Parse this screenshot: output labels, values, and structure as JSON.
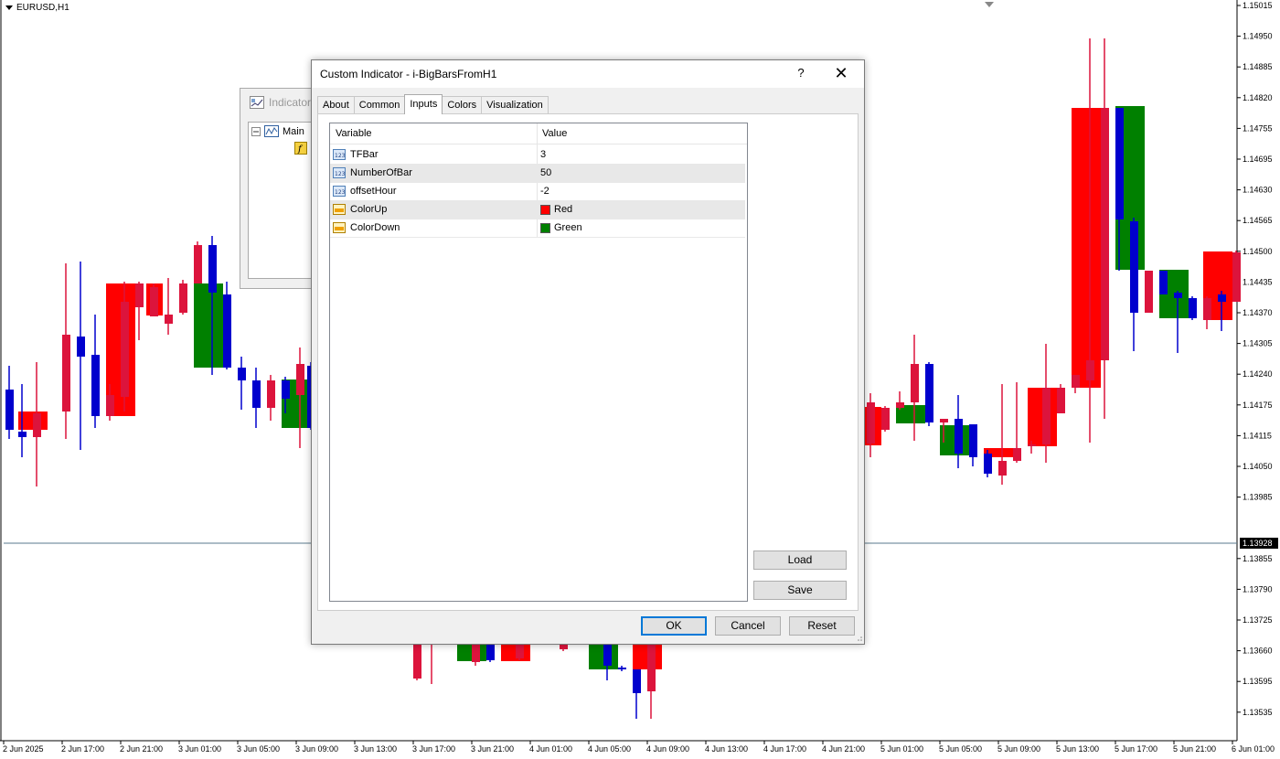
{
  "chart": {
    "symbol_label": "EURUSD,H1",
    "current_price": "1.13928",
    "price_labels": [
      "1.15015",
      "1.14950",
      "1.14885",
      "1.14820",
      "1.14755",
      "1.14695",
      "1.14630",
      "1.14565",
      "1.14500",
      "1.14435",
      "1.14370",
      "1.14305",
      "1.14240",
      "1.14175",
      "1.14115",
      "1.14050",
      "1.13985",
      "1.13855",
      "1.13790",
      "1.13725",
      "1.13660",
      "1.13595",
      "1.13535"
    ],
    "time_labels": [
      "2 Jun 2025",
      "2 Jun 17:00",
      "2 Jun 21:00",
      "3 Jun 01:00",
      "3 Jun 05:00",
      "3 Jun 09:00",
      "3 Jun 13:00",
      "3 Jun 17:00",
      "3 Jun 21:00",
      "4 Jun 01:00",
      "4 Jun 05:00",
      "4 Jun 09:00",
      "4 Jun 13:00",
      "4 Jun 17:00",
      "4 Jun 21:00",
      "5 Jun 01:00",
      "5 Jun 05:00",
      "5 Jun 09:00",
      "5 Jun 13:00",
      "5 Jun 17:00",
      "5 Jun 21:00",
      "6 Jun 01:00"
    ],
    "colors": {
      "up": "#ff0000",
      "down": "#008000",
      "bull": "#dc143c",
      "bear": "#0000cd",
      "line": "#5a7a8c"
    }
  },
  "bg_window": {
    "title": "Indicator",
    "tree_main": "Main"
  },
  "dialog": {
    "title": "Custom Indicator - i-BigBarsFromH1",
    "help": "?",
    "close": "✕",
    "tabs": [
      {
        "label": "About"
      },
      {
        "label": "Common"
      },
      {
        "label": "Inputs",
        "active": true
      },
      {
        "label": "Colors"
      },
      {
        "label": "Visualization"
      }
    ],
    "grid": {
      "col_variable": "Variable",
      "col_value": "Value",
      "rows": [
        {
          "name": "TFBar",
          "value": "3",
          "icon": "number-icon"
        },
        {
          "name": "NumberOfBar",
          "value": "50",
          "icon": "number-icon"
        },
        {
          "name": "offsetHour",
          "value": "-2",
          "icon": "number-icon"
        },
        {
          "name": "ColorUp",
          "value": "Red",
          "icon": "color-icon",
          "color": "#ff0000"
        },
        {
          "name": "ColorDown",
          "value": "Green",
          "icon": "color-icon",
          "color": "#008000"
        }
      ]
    },
    "buttons": {
      "load": "Load",
      "save": "Save",
      "ok": "OK",
      "cancel": "Cancel",
      "reset": "Reset"
    }
  }
}
